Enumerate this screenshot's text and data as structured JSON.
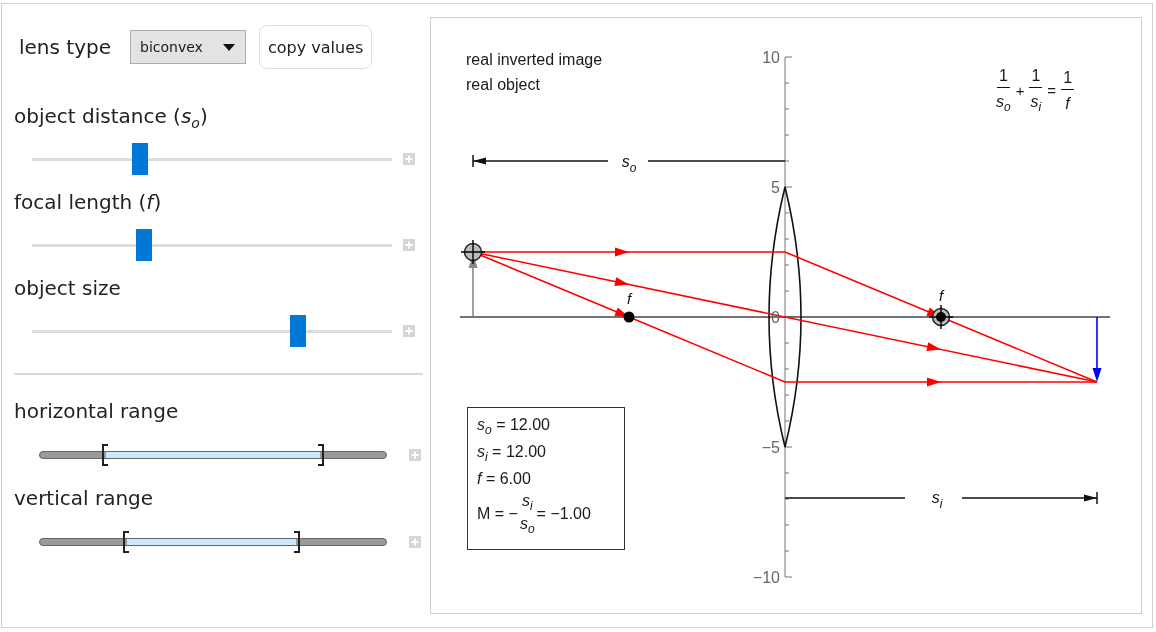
{
  "controls": {
    "lens_type": {
      "label": "lens type",
      "value": "biconvex"
    },
    "copy_button": "copy values"
  },
  "sliders": [
    {
      "label": "object distance (*s*$_{o}$)",
      "level": 0.3
    },
    {
      "label": "focal length (*f*)",
      "level": 0.31
    },
    {
      "label": "object size",
      "level": 0.74
    }
  ],
  "range_sliders": [
    {
      "label": "horizontal range",
      "handles": [
        {
          "level": 0.19
        },
        {
          "level": 0.81
        }
      ]
    },
    {
      "label": "vertical range",
      "handles": [
        {
          "level": 0.25
        },
        {
          "level": 0.74
        }
      ]
    }
  ],
  "diagram": {
    "notes": [
      "real inverted image",
      "real object"
    ],
    "y_ticks": [
      "10",
      "5",
      "0",
      "−5",
      "−10"
    ],
    "formula": {
      "terms": [
        {
          "numerator": "1",
          "denominator": "s$_{o}$"
        },
        {
          "numerator": "1",
          "denominator": "s$_{i}$"
        },
        {
          "numerator": "1",
          "denominator": "f"
        }
      ],
      "plus": "+",
      "equals": "="
    },
    "object_distance_label": "s$_{o}$",
    "image_distance_label": "s$_{i}$",
    "focal_labels": [
      "f",
      "f"
    ],
    "readout": {
      "lines": [
        "*s*$_{o}$ = 12.00",
        "*s*$_{i}$ = 12.00",
        "*f* = 6.00"
      ],
      "magnification": {
        "prefix": "M = −",
        "numerator": "s$_{i}$",
        "denominator": "s$_{o}$",
        "result": "= −1.00"
      }
    }
  }
}
